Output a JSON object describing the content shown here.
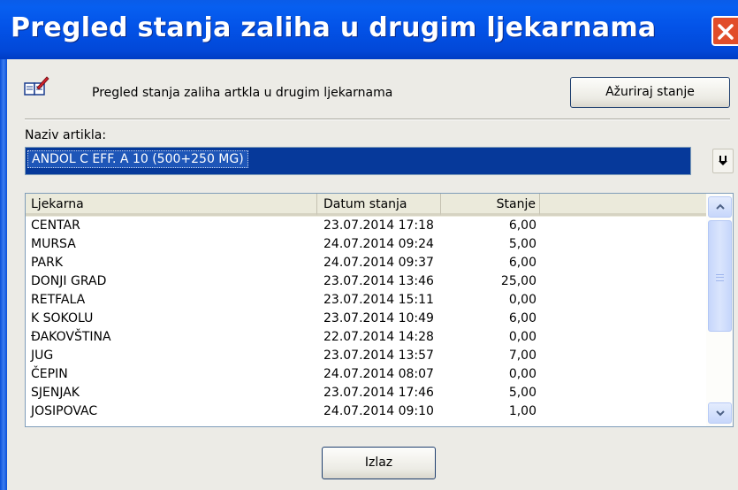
{
  "window": {
    "title": "Pregled stanja zaliha u drugim ljekarnama",
    "close_icon": "close-icon"
  },
  "header": {
    "icon": "book-pencil-icon",
    "label": "Pregled stanja zaliha artkla u drugim ljekarnama",
    "update_button": "Ažuriraj stanje"
  },
  "article": {
    "label": "Naziv artikla:",
    "value": "ANDOL C EFF. A 10 (500+250 MG)",
    "dropdown_icon": "download-arrow-icon"
  },
  "table": {
    "columns": [
      "Ljekarna",
      "Datum stanja",
      "Stanje"
    ],
    "rows": [
      [
        "CENTAR",
        "23.07.2014 17:18",
        "6,00"
      ],
      [
        "MURSA",
        "24.07.2014 09:24",
        "5,00"
      ],
      [
        "PARK",
        "24.07.2014 09:37",
        "6,00"
      ],
      [
        "DONJI GRAD",
        "23.07.2014 13:46",
        "25,00"
      ],
      [
        "RETFALA",
        "23.07.2014 15:11",
        "0,00"
      ],
      [
        "K SOKOLU",
        "23.07.2014 10:49",
        "6,00"
      ],
      [
        "ĐAKOVŠTINA",
        "22.07.2014 14:28",
        "0,00"
      ],
      [
        "JUG",
        "23.07.2014 13:57",
        "7,00"
      ],
      [
        "ČEPIN",
        "24.07.2014 08:07",
        "0,00"
      ],
      [
        "SJENJAK",
        "23.07.2014 17:46",
        "5,00"
      ],
      [
        "JOSIPOVAC",
        "24.07.2014 09:10",
        "1,00"
      ]
    ]
  },
  "footer": {
    "exit_button": "Izlaz"
  },
  "colors": {
    "titlebar": "#0353e8",
    "selection": "#06399a",
    "close": "#e14d2a"
  }
}
